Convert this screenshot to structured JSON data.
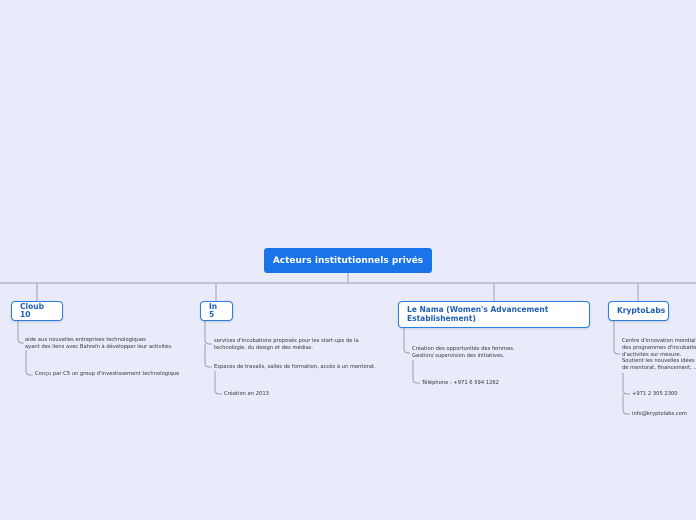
{
  "mindmap": {
    "root": {
      "label": "Acteurs institutionnels privés"
    },
    "branches": [
      {
        "title": "Cloub 10",
        "items": [
          {
            "text": "aide aux nouvelles entreprises technologiques\nayant des liens avec Bahreïn à développer leur activités."
          },
          {
            "text": "Conçu par C5 un group d'investissement technologique"
          }
        ]
      },
      {
        "title": "In 5",
        "items": [
          {
            "text": "services d'incubations proposés pour les start-ups de la\ntechnologie, du design et des médias."
          },
          {
            "text": "Espaces de travails, salles de formation, accès à un mentorat."
          },
          {
            "text": "Création en 2013"
          }
        ]
      },
      {
        "title": "Le Nama (Women's Advancement\nEstablishement)",
        "items": [
          {
            "text": "Création des opportunités des femmes.\nGestion/ supervision des initiatives."
          },
          {
            "text": "Téléphone : +971 6 594 1262"
          }
        ]
      },
      {
        "title": "KryptoLabs",
        "items": [
          {
            "text": "Centre d'innovation mondial\ndes programmes d'incubation\nd'activités sur mesure.\nSoutient les nouvelles idées\nde mentorat, financement, ..."
          },
          {
            "text": "+971 2 305 2300"
          },
          {
            "text": "info@kryptolabs.com"
          }
        ]
      }
    ]
  }
}
